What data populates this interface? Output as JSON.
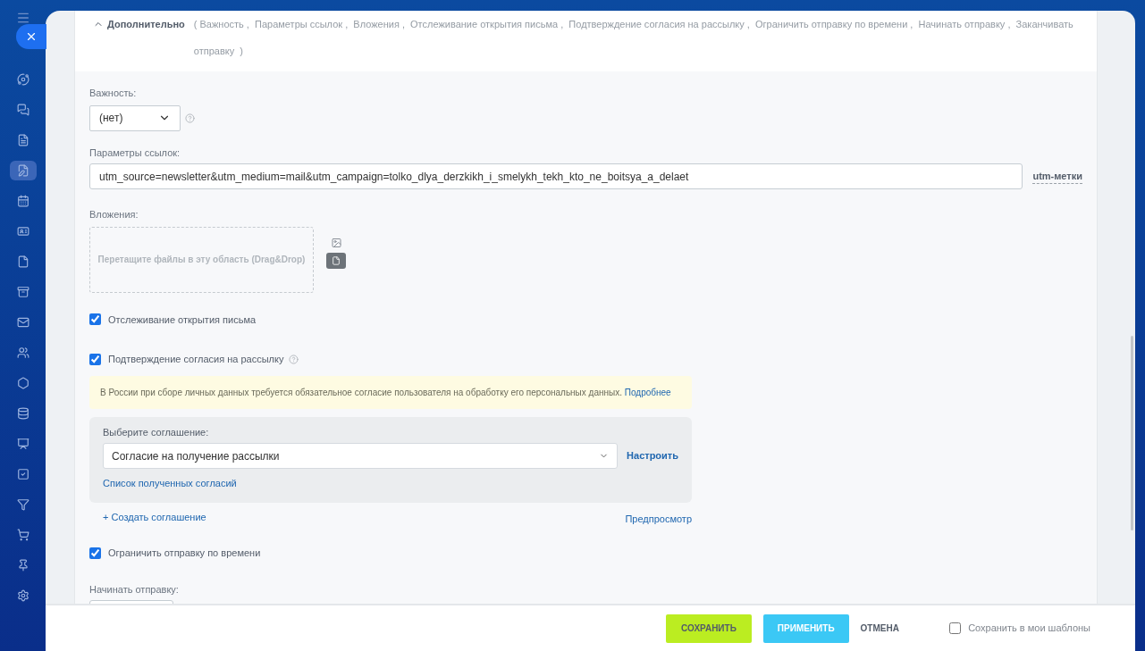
{
  "sidebar": {
    "items": [
      {
        "selected": false
      },
      {
        "selected": false
      },
      {
        "selected": false
      },
      {
        "selected": true
      },
      {
        "selected": false
      },
      {
        "selected": false
      },
      {
        "selected": false
      },
      {
        "selected": false
      },
      {
        "selected": false
      },
      {
        "selected": false
      },
      {
        "selected": false
      },
      {
        "selected": false
      },
      {
        "selected": false
      },
      {
        "selected": false
      },
      {
        "selected": false
      },
      {
        "selected": false
      },
      {
        "selected": false
      },
      {
        "selected": false
      }
    ]
  },
  "section": {
    "title": "Дополнительно",
    "expanded": true,
    "summary": "( Важность ,  Параметры ссылок ,  Вложения ,  Отслеживание открытия письма ,  Подтверждение согласия на рассылку ,  Ограничить отправку по времени ,  Начинать отправку ,  Заканчивать отправку  )"
  },
  "importance": {
    "label": "Важность:",
    "value": "(нет)"
  },
  "link_params": {
    "label": "Параметры ссылок:",
    "value": "utm_source=newsletter&utm_medium=mail&utm_campaign=tolko_dlya_derzkikh_i_smelykh_tekh_kto_ne_boitsya_a_delaet",
    "link": "utm-метки"
  },
  "attachments": {
    "label": "Вложения:",
    "dropzone": "Перетащите файлы в эту область (Drag&Drop)"
  },
  "tracking": {
    "label": "Отслеживание открытия письма",
    "checked": true
  },
  "consent": {
    "label": "Подтверждение согласия на рассылку",
    "checked": true,
    "notice": "В России при сборе личных данных требуется обязательное согласие пользователя на обработку его персональных данных.",
    "notice_link": "Подробнее",
    "select_label": "Выберите соглашение:",
    "select_value": "Согласие на получение рассылки",
    "configure": "Настроить",
    "list_link": "Список полученных согласий",
    "create": "+ Создать соглашение",
    "preview": "Предпросмотр"
  },
  "time_limit": {
    "label": "Ограничить отправку по времени",
    "checked": true
  },
  "start": {
    "label": "Начинать отправку:"
  },
  "footer": {
    "buttons": [
      {
        "label": "СОХРАНИТЬ",
        "kind": "save"
      },
      {
        "label": "ПРИМЕНИТЬ",
        "kind": "apply"
      },
      {
        "label": "ОТМЕНА",
        "kind": "cancel"
      }
    ],
    "template": {
      "label": "Сохранить в мои шаблоны",
      "checked": false
    }
  }
}
